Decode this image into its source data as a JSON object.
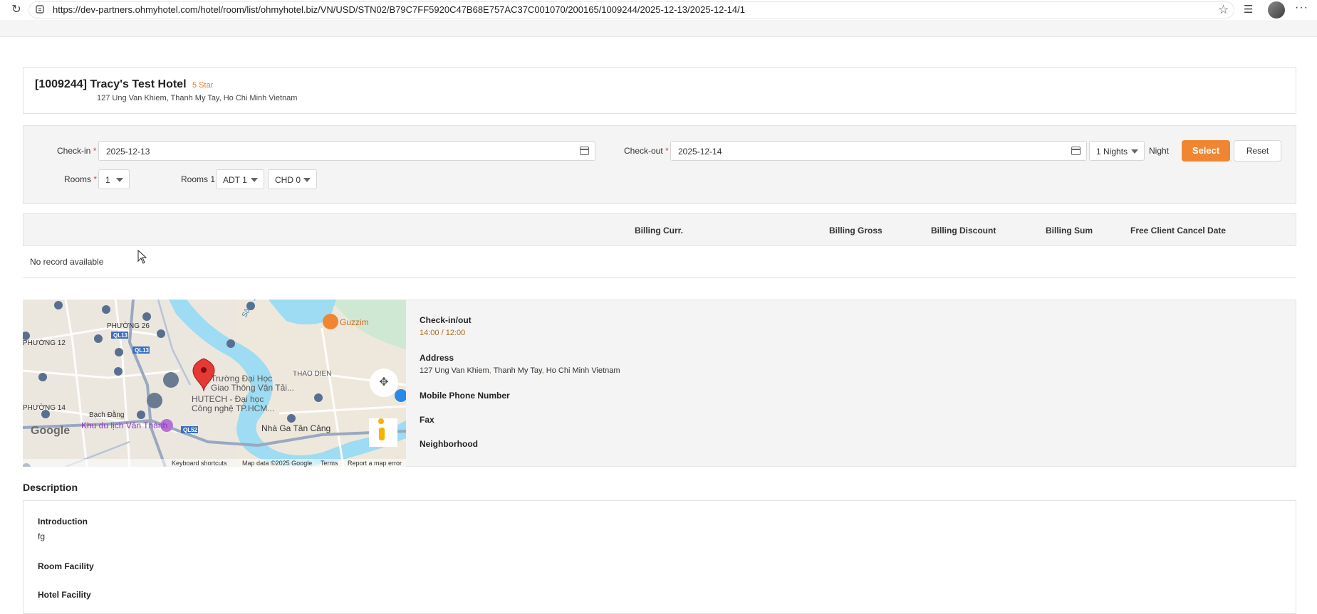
{
  "browser": {
    "url": "https://dev-partners.ohmyhotel.com/hotel/room/list/ohmyhotel.biz/VN/USD/STN02/B79C7FF5920C47B68E757AC37C001070/200165/1009244/2025-12-13/2025-12-14/1"
  },
  "hotel": {
    "id_name": "[1009244] Tracy's Test Hotel",
    "star": "5 Star",
    "address": "127 Ung Van Khiem, Thanh My Tay, Ho Chi Minh Vietnam"
  },
  "search": {
    "checkin_label": "Check-in",
    "checkin_value": "2025-12-13",
    "checkout_label": "Check-out",
    "checkout_value": "2025-12-14",
    "nights_value": "1 Nights",
    "night_label": "Night",
    "select_label": "Select",
    "reset_label": "Reset",
    "rooms_label": "Rooms",
    "rooms_value": "1",
    "room1_label": "Rooms 1",
    "adt_value": "ADT 1",
    "chd_value": "CHD 0",
    "required_mark": "*"
  },
  "table": {
    "columns": [
      "Billing Curr.",
      "Billing Gross",
      "Billing Discount",
      "Billing Sum",
      "Free Client Cancel Date"
    ],
    "empty_text": "No record available"
  },
  "map": {
    "labels": {
      "phuong26": "PHƯỜNG 26",
      "phuong12": "PHƯỜNG 12",
      "phuong14": "PHƯỜNG 14",
      "bachdang": "Bạch Đằng",
      "ql13a": "QL13",
      "ql13b": "QL13",
      "ql52": "QL52",
      "river": "Sông Sài Gòn",
      "thaodien": "THAO DIEN",
      "guzzim": "Guzzim",
      "truong1": "Trường Đại Học",
      "truong2": "Giao Thông Vận Tải...",
      "hutech1": "HUTECH - Đại học",
      "hutech2": "Công nghệ TP.HCM...",
      "khudulich": "Khu du lịch Văn Thánh",
      "nhaga": "Nhà Ga Tân Cảng",
      "google": "Google",
      "keyboard": "Keyboard shortcuts",
      "mapdata": "Map data ©2025 Google",
      "terms": "Terms",
      "report": "Report a map error"
    }
  },
  "info": {
    "checkinout_label": "Check-in/out",
    "checkinout_value": "14:00 / 12:00",
    "address_label": "Address",
    "address_p1": "127 Ung Van Khiem",
    "address_p2": "Thanh My Tay",
    "address_p3": "Ho Chi Minh Vietnam",
    "mobile_label": "Mobile Phone Number",
    "fax_label": "Fax",
    "neighborhood_label": "Neighborhood"
  },
  "description": {
    "title": "Description",
    "intro_label": "Introduction",
    "intro_value": "fg",
    "room_facility_label": "Room Facility",
    "hotel_facility_label": "Hotel Facility"
  },
  "colors": {
    "accent": "#f08632",
    "star": "#e8791d",
    "required": "#e0442b"
  }
}
